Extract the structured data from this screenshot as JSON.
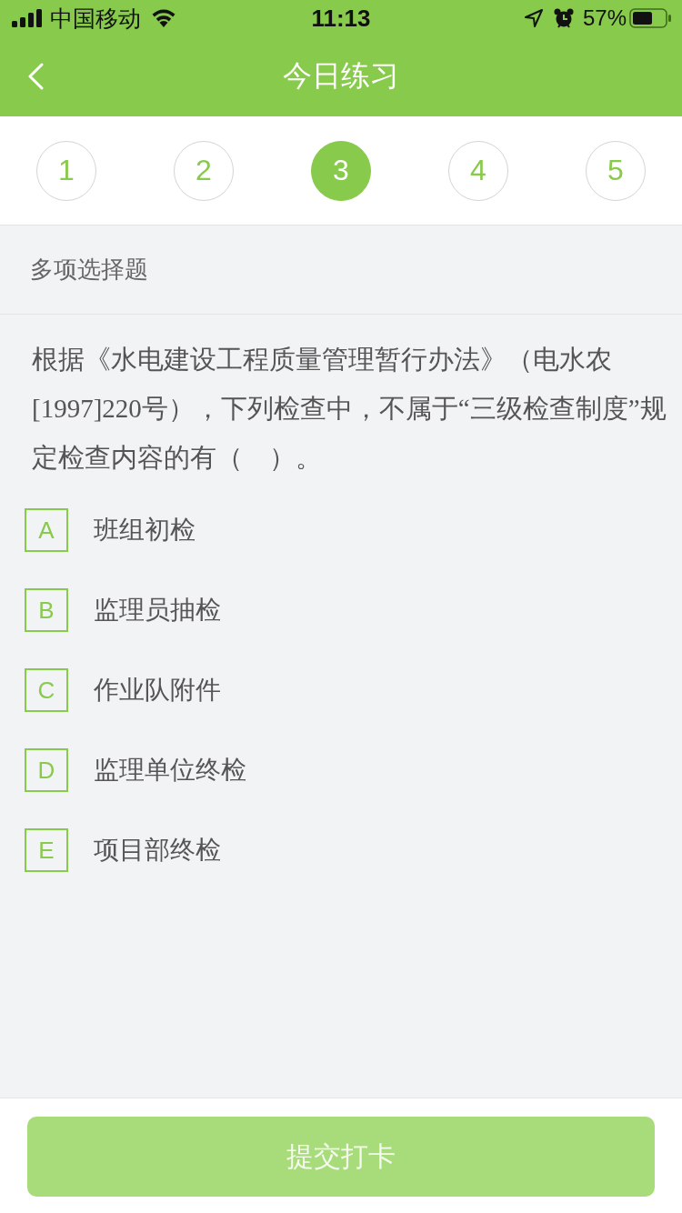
{
  "status_bar": {
    "carrier": "中国移动",
    "time": "11:13",
    "battery": "57%"
  },
  "nav_bar": {
    "title": "今日练习"
  },
  "question_tabs": [
    {
      "label": "1",
      "selected": false
    },
    {
      "label": "2",
      "selected": false
    },
    {
      "label": "3",
      "selected": true
    },
    {
      "label": "4",
      "selected": false
    },
    {
      "label": "5",
      "selected": false
    }
  ],
  "section_title": "多项选择题",
  "question": "根据《水电建设工程质量管理暂行办法》（电水农[1997]220号），下列检查中，不属于“三级检查制度”规定检查内容的有（　）。",
  "options": [
    {
      "letter": "A",
      "text": "班组初检",
      "selected": false
    },
    {
      "letter": "B",
      "text": "监理员抽检",
      "selected": false
    },
    {
      "letter": "C",
      "text": "作业队附件",
      "selected": false
    },
    {
      "letter": "D",
      "text": "监理单位终检",
      "selected": false
    },
    {
      "letter": "E",
      "text": "项目部终检",
      "selected": false
    }
  ],
  "submit_button": {
    "label": "提交打卡",
    "disabled": true
  }
}
